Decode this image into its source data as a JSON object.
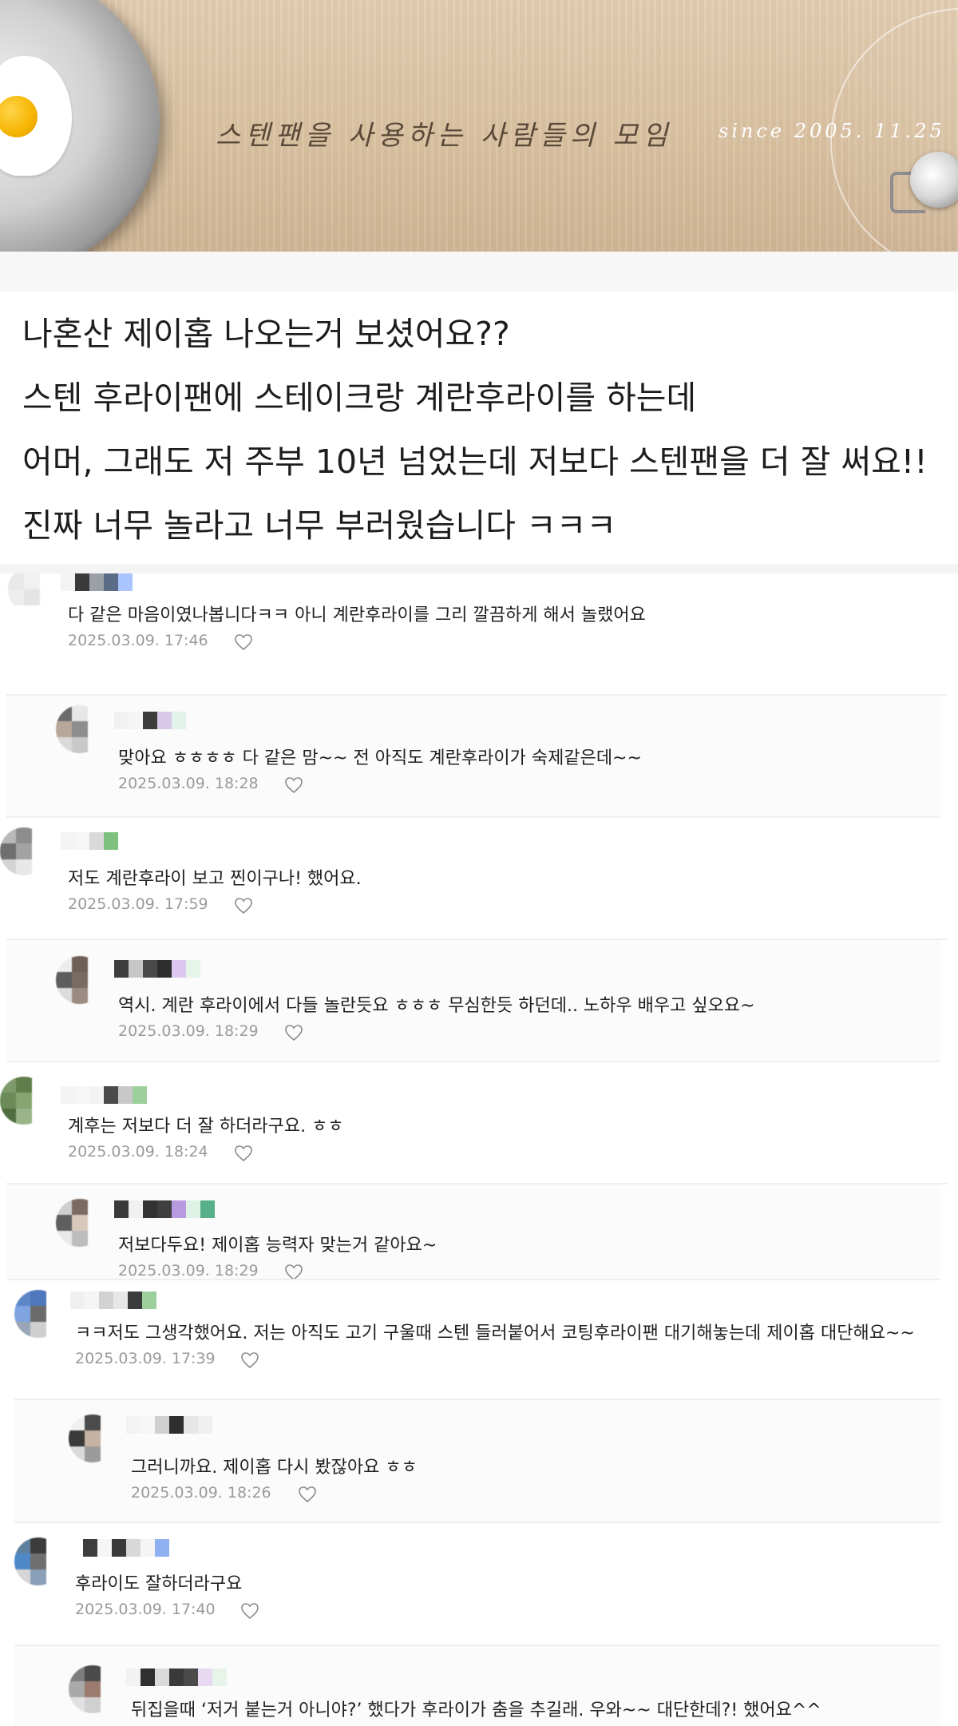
{
  "banner": {
    "title": "스텐팬을 사용하는 사람들의 모임",
    "since": "since 2005. 11.25"
  },
  "post": {
    "lines": [
      "나혼산 제이홉 나오는거 보셨어요??",
      "스텐 후라이팬에 스테이크랑 계란후라이를 하는데",
      "어머, 그래도 저 주부 10년 넘었는데 저보다 스텐팬을 더 잘 써요!!",
      "진짜 너무 놀라고 너무 부러웠습니다 ㅋㅋㅋ"
    ]
  },
  "comments": [
    {
      "text": "다 같은 마음이였나봅니다ㅋㅋ 아니 계란후라이를 그리 깔끔하게 해서 놀랬어요",
      "date": "2025.03.09. 17:46"
    },
    {
      "text": "맞아요 ㅎㅎㅎㅎ 다 같은 맘~~ 전 아직도 계란후라이가 숙제같은데~~",
      "date": "2025.03.09. 18:28"
    },
    {
      "text": "저도 계란후라이 보고 찐이구나! 했어요.",
      "date": "2025.03.09. 17:59"
    },
    {
      "text": "역시. 계란 후라이에서 다들 놀란듯요 ㅎㅎㅎ 무심한듯 하던데.. 노하우 배우고 싶오요~",
      "date": "2025.03.09. 18:29"
    },
    {
      "text": "계후는 저보다 더 잘 하더라구요. ㅎㅎ",
      "date": "2025.03.09. 18:24"
    },
    {
      "text": "저보다두요! 제이홉 능력자 맞는거 같아요~",
      "date": "2025.03.09. 18:29"
    },
    {
      "text": "ㅋㅋ저도 그생각했어요. 저는 아직도 고기 구울때 스텐 들러붙어서 코팅후라이팬 대기해놓는데 제이홉 대단해요~~",
      "date": "2025.03.09. 17:39"
    },
    {
      "text": "그러니까요. 제이홉 다시 봤잖아요 ㅎㅎ",
      "date": "2025.03.09. 18:26"
    },
    {
      "text": "후라이도 잘하더라구요",
      "date": "2025.03.09. 17:40"
    },
    {
      "text": "뒤집을때 ‘저거 붙는거 아니야?’ 했다가 후라이가 춤을 추길래. 우와~~ 대단한데?! 했어요^^",
      "date": ""
    }
  ],
  "icons": {
    "like": "heart-outline-icon"
  },
  "colors": {
    "date": "#9a9a9a",
    "banner": "#d9c1a2"
  }
}
